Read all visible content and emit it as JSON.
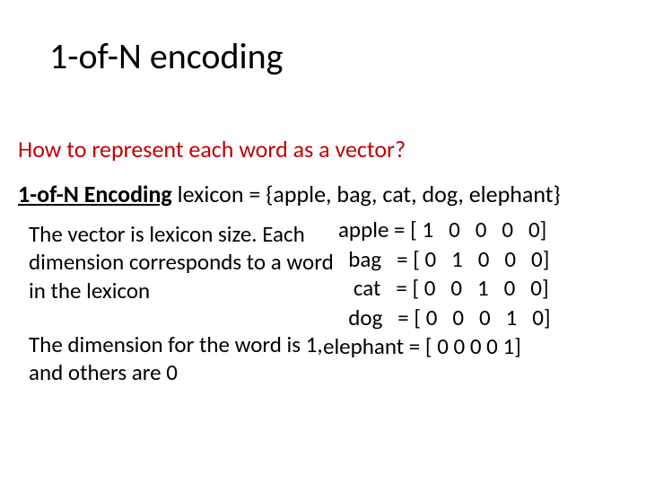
{
  "title": "1-of-N encoding",
  "question": "How to represent each word as a vector?",
  "subhead": {
    "label": "1-of-N Encoding",
    "rest": "   lexicon = {apple, bag, cat, dog, elephant}"
  },
  "para1": "The vector is lexicon size. Each dimension corresponds to a word in the lexicon",
  "para2": "The dimension for the word is 1, and others are 0",
  "vectors": {
    "r1": "   apple = [ 1   0   0   0   0]",
    "r2": "     bag   = [ 0   1   0   0   0]",
    "r3": "      cat   = [ 0   0   1   0   0]",
    "r4": "     dog   = [ 0   0   0   1   0]",
    "r5": "elephant  = [ 0   0   0   0   1]"
  }
}
